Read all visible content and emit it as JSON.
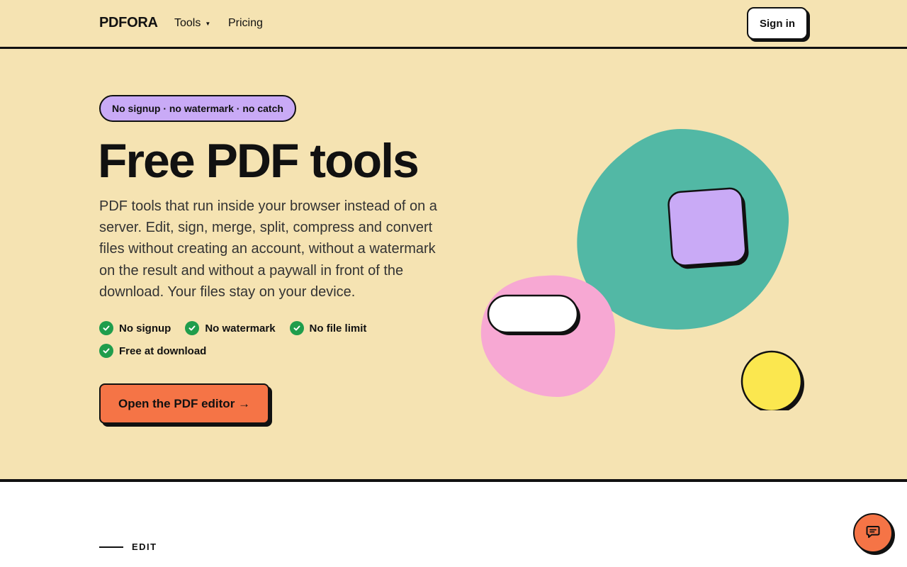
{
  "header": {
    "logo": "PDFORA",
    "nav": {
      "tools_label": "Tools",
      "pricing_label": "Pricing"
    },
    "signin_label": "Sign in"
  },
  "hero": {
    "badge": "No signup · no watermark · no catch",
    "title": "Free PDF tools",
    "description": "PDF tools that run inside your browser instead of on a server. Edit, sign, merge, split, compress and convert files without creating an account, without a watermark on the result and without a paywall in front of the download. Your files stay on your device.",
    "features": [
      "No signup",
      "No watermark",
      "No file limit",
      "Free at download"
    ],
    "cta_label": "Open the PDF editor →"
  },
  "section": {
    "label": "EDIT"
  },
  "icons": {
    "feature_check": "check-circle-icon",
    "chat": "chat-bubble-icon",
    "tools_caret": "caret-down-icon"
  },
  "colors": {
    "hero_background": "#f5e3b2",
    "accent_orange": "#f57446",
    "badge_purple": "#c9aaf6",
    "check_green": "#1f9d4c",
    "shape_teal": "#52b8a5",
    "shape_pink": "#f7a8d3",
    "shape_yellow": "#fbe74f",
    "outline": "#111111"
  }
}
